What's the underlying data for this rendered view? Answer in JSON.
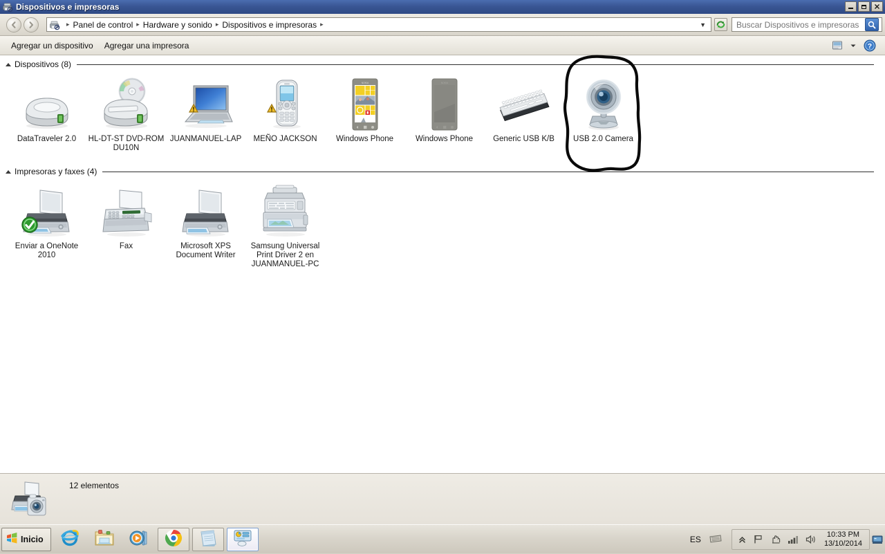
{
  "window": {
    "title": "Dispositivos e impresoras",
    "icon": "printer-device-icon",
    "minimize_label": "_",
    "restore_label": "❐",
    "close_label": "✕"
  },
  "navigation": {
    "back_glyph": "◀",
    "forward_glyph": "▶",
    "breadcrumb_icon": "printer-device-icon",
    "breadcrumbs": [
      {
        "label": "Panel de control"
      },
      {
        "label": "Hardware y sonido"
      },
      {
        "label": "Dispositivos e impresoras"
      }
    ],
    "separator": "▸",
    "address_dropdown_glyph": "▼",
    "refresh_icon": "refresh-icon"
  },
  "search": {
    "placeholder": "Buscar Dispositivos e impresoras",
    "value": "",
    "button_icon": "search-icon"
  },
  "command_bar": {
    "items": [
      {
        "label": "Agregar un dispositivo",
        "name": "add-device-button"
      },
      {
        "label": "Agregar una impresora",
        "name": "add-printer-button"
      }
    ],
    "view_icon": "change-view-icon",
    "view_dropdown_glyph": "▼",
    "help_icon": "help-icon",
    "help_label": "?"
  },
  "groups": [
    {
      "name": "devices-group",
      "label": "Dispositivos (8)",
      "items": [
        {
          "label": "DataTraveler 2.0",
          "icon": "usb-drive-icon",
          "badge": "none",
          "name": "device-datatraveler"
        },
        {
          "label": "HL-DT-ST DVD-ROM DU10N",
          "icon": "dvd-drive-icon",
          "badge": "none",
          "name": "device-dvd-rom"
        },
        {
          "label": "JUANMANUEL-LAP",
          "icon": "laptop-icon",
          "badge": "warning",
          "name": "device-juanmanuel-lap"
        },
        {
          "label": "MEÑO JACKSON",
          "icon": "mobile-phone-icon",
          "badge": "warning",
          "name": "device-meno-jackson"
        },
        {
          "label": "Windows Phone",
          "icon": "windows-phone-tiles-icon",
          "badge": "none",
          "name": "device-windows-phone-1"
        },
        {
          "label": "Windows Phone",
          "icon": "windows-phone-gray-icon",
          "badge": "none",
          "name": "device-windows-phone-2"
        },
        {
          "label": "Generic USB K/B",
          "icon": "keyboard-icon",
          "badge": "none",
          "name": "device-generic-usb-kb"
        },
        {
          "label": "USB 2.0 Camera",
          "icon": "webcam-icon",
          "badge": "none",
          "name": "device-usb-camera",
          "annotated": true
        }
      ]
    },
    {
      "name": "printers-group",
      "label": "Impresoras y faxes (4)",
      "items": [
        {
          "label": "Enviar a OneNote 2010",
          "icon": "printer-icon",
          "badge": "default-check",
          "name": "printer-onenote-2010"
        },
        {
          "label": "Fax",
          "icon": "fax-icon",
          "badge": "none",
          "name": "printer-fax"
        },
        {
          "label": "Microsoft XPS Document Writer",
          "icon": "printer-icon",
          "badge": "none",
          "name": "printer-xps-writer"
        },
        {
          "label": "Samsung Universal Print Driver 2 en JUANMANUEL-PC",
          "icon": "multifunction-printer-icon",
          "badge": "none",
          "name": "printer-samsung-universal"
        }
      ]
    }
  ],
  "details_pane": {
    "icon": "printer-camera-icon",
    "status": "12 elementos"
  },
  "taskbar": {
    "start_label": "Inicio",
    "start_icon": "windows-flag-icon",
    "buttons": [
      {
        "name": "taskbar-internet-explorer",
        "icon": "internet-explorer-icon",
        "style": "flat"
      },
      {
        "name": "taskbar-windows-explorer",
        "icon": "folder-explorer-icon",
        "style": "flat"
      },
      {
        "name": "taskbar-media-player",
        "icon": "media-player-icon",
        "style": "flat"
      },
      {
        "name": "taskbar-google-chrome",
        "icon": "chrome-icon",
        "style": "framed"
      },
      {
        "name": "taskbar-notepad",
        "icon": "notepad-icon",
        "style": "framed"
      },
      {
        "name": "taskbar-devices-printers",
        "icon": "control-panel-icon",
        "style": "active"
      }
    ],
    "tray": {
      "language": "ES",
      "keyboard_icon": "keyboard-tray-icon",
      "expand_glyph": "«",
      "icons": [
        {
          "name": "action-center-flag-icon"
        },
        {
          "name": "safely-remove-hardware-icon"
        },
        {
          "name": "network-signal-icon"
        },
        {
          "name": "volume-speaker-icon"
        }
      ],
      "clock_time": "10:33 PM",
      "clock_date": "13/10/2014",
      "show_desktop_icon": "show-desktop-icon"
    }
  },
  "annotation": {
    "type": "hand-drawn-circle",
    "color": "#000000",
    "target": "USB 2.0 Camera"
  }
}
